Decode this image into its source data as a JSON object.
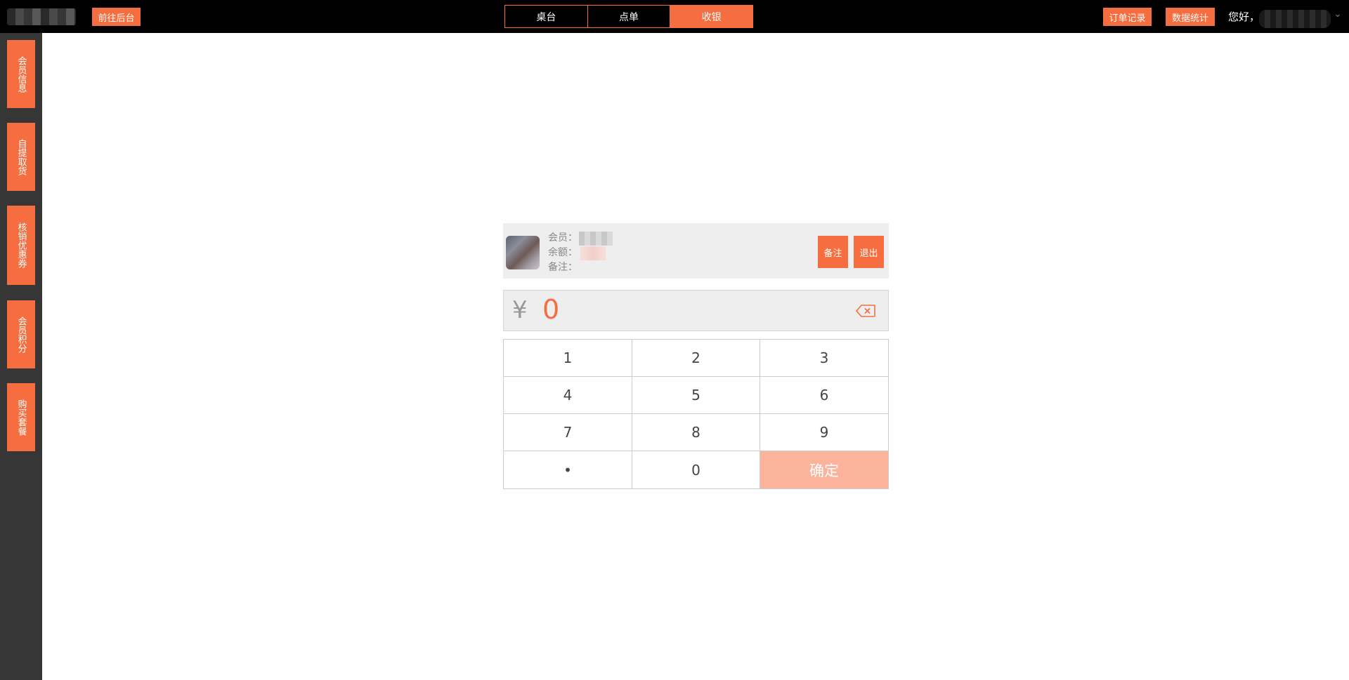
{
  "header": {
    "backend_label": "前往后台",
    "tabs": [
      {
        "label": "桌台",
        "active": false
      },
      {
        "label": "点单",
        "active": false
      },
      {
        "label": "收银",
        "active": true
      }
    ],
    "orders_label": "订单记录",
    "stats_label": "数据统计",
    "greeting": "您好，"
  },
  "sidebar": {
    "items": [
      {
        "label": "会员信息"
      },
      {
        "label": "自提取货"
      },
      {
        "label": "核销优惠券"
      },
      {
        "label": "会员积分"
      },
      {
        "label": "购买套餐"
      }
    ]
  },
  "member": {
    "name_label": "会员：",
    "balance_label": "余额：",
    "note_label": "备注：",
    "note_button": "备注",
    "logout_button": "退出"
  },
  "amount": {
    "currency": "¥",
    "value": "0"
  },
  "keypad": {
    "keys": [
      "1",
      "2",
      "3",
      "4",
      "5",
      "6",
      "7",
      "8",
      "9",
      "•",
      "0"
    ],
    "confirm_label": "确定"
  },
  "colors": {
    "accent": "#f66d3f",
    "confirm_disabled": "#fbb39c",
    "topbar": "#000000",
    "sidebar": "#363636",
    "panel": "#eeeeee"
  },
  "icons": {
    "backspace": "backspace-icon",
    "user_menu": "chevron-down-icon"
  }
}
